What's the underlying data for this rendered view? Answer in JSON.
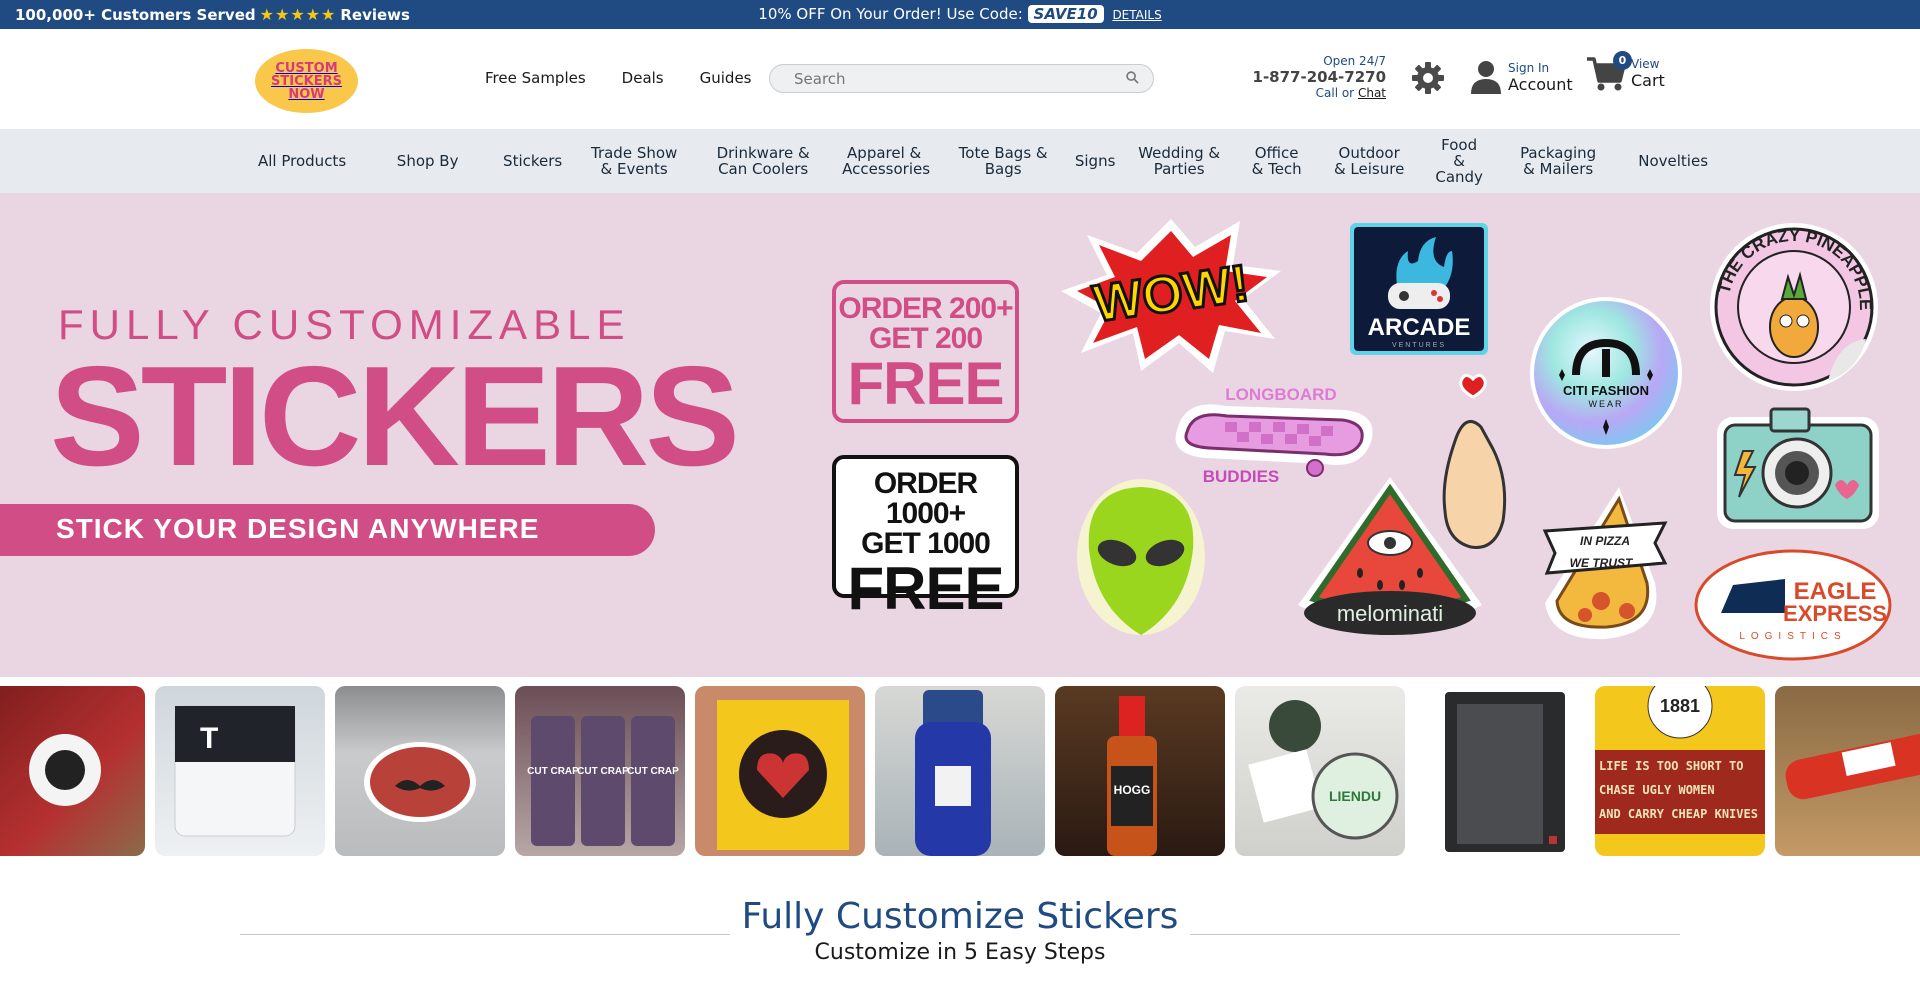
{
  "topbar": {
    "customers": "100,000+ Customers Served",
    "stars": "★★★★★",
    "reviews": "Reviews",
    "promo_text": "10% OFF On Your Order! Use Code:",
    "promo_code": "SAVE10",
    "details": "DETAILS"
  },
  "header": {
    "logo_line1": "CUSTOM",
    "logo_line2": "STICKERS",
    "logo_line3": "NOW",
    "links": [
      "Free Samples",
      "Deals",
      "Guides"
    ],
    "search_placeholder": "Search",
    "open": "Open 24/7",
    "phone": "1-877-204-7270",
    "call_or": "Call or",
    "chat": "Chat",
    "sign_in": "Sign In",
    "account": "Account",
    "cart_count": "0",
    "view": "View",
    "cart": "Cart"
  },
  "categories": [
    "All Products",
    "Shop By",
    "Stickers",
    "Trade Show & Events",
    "Drinkware & Can Coolers",
    "Apparel & Accessories",
    "Tote Bags & Bags",
    "Signs",
    "Wedding & Parties",
    "Office & Tech",
    "Outdoor & Leisure",
    "Food & Candy",
    "Packaging & Mailers",
    "Novelties"
  ],
  "hero": {
    "fully": "FULLY CUSTOMIZABLE",
    "stickers": "STICKERS",
    "band": "STICK YOUR DESIGN ANYWHERE",
    "offer1": {
      "l1": "ORDER 200+",
      "l2": "GET 200",
      "l3": "FREE"
    },
    "offer2": {
      "l1": "ORDER 1000+",
      "l2": "GET 1000",
      "l3": "FREE"
    },
    "sticker_text": {
      "wow": "WOW!",
      "arcade": "ARCADE",
      "arcade_sub": "VENTURES",
      "pineapple": "THE CRAZY PINEAPPLE",
      "longboard": "LONGBOARD",
      "buddies": "BUDDIES",
      "citi": "CITI FASHION",
      "wear": "WEAR",
      "melo": "melominati",
      "in_pizza": "IN PIZZA",
      "we_trust": "WE TRUST",
      "eagle": "EAGLE",
      "express": "EXPRESS",
      "logistics": "LOGISTICS"
    }
  },
  "photo_text": {
    "crap": "CUT CRAP",
    "hogg": "HOGG",
    "liendu": "LIENDU",
    "badge1881": "1881",
    "sign_line1": "LIFE IS TOO SHORT TO",
    "sign_line2": "CHASE UGLY WOMEN",
    "sign_line3": "AND CARRY CHEAP KNIVES"
  },
  "section": {
    "title": "Fully Customize Stickers",
    "subtitle": "Customize in 5 Easy Steps"
  },
  "colors": {
    "brand_blue": "#1f4a82",
    "pink": "#d14d86",
    "hero_bg": "#ead6e3",
    "nav_bg": "#e7ebef"
  }
}
